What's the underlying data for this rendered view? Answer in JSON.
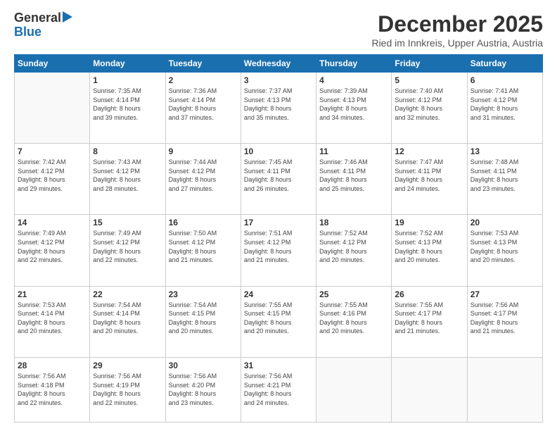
{
  "header": {
    "logo_line1": "General",
    "logo_line2": "Blue",
    "month": "December 2025",
    "location": "Ried im Innkreis, Upper Austria, Austria"
  },
  "weekdays": [
    "Sunday",
    "Monday",
    "Tuesday",
    "Wednesday",
    "Thursday",
    "Friday",
    "Saturday"
  ],
  "weeks": [
    [
      {
        "day": "",
        "info": ""
      },
      {
        "day": "1",
        "info": "Sunrise: 7:35 AM\nSunset: 4:14 PM\nDaylight: 8 hours\nand 39 minutes."
      },
      {
        "day": "2",
        "info": "Sunrise: 7:36 AM\nSunset: 4:14 PM\nDaylight: 8 hours\nand 37 minutes."
      },
      {
        "day": "3",
        "info": "Sunrise: 7:37 AM\nSunset: 4:13 PM\nDaylight: 8 hours\nand 35 minutes."
      },
      {
        "day": "4",
        "info": "Sunrise: 7:39 AM\nSunset: 4:13 PM\nDaylight: 8 hours\nand 34 minutes."
      },
      {
        "day": "5",
        "info": "Sunrise: 7:40 AM\nSunset: 4:12 PM\nDaylight: 8 hours\nand 32 minutes."
      },
      {
        "day": "6",
        "info": "Sunrise: 7:41 AM\nSunset: 4:12 PM\nDaylight: 8 hours\nand 31 minutes."
      }
    ],
    [
      {
        "day": "7",
        "info": "Sunrise: 7:42 AM\nSunset: 4:12 PM\nDaylight: 8 hours\nand 29 minutes."
      },
      {
        "day": "8",
        "info": "Sunrise: 7:43 AM\nSunset: 4:12 PM\nDaylight: 8 hours\nand 28 minutes."
      },
      {
        "day": "9",
        "info": "Sunrise: 7:44 AM\nSunset: 4:12 PM\nDaylight: 8 hours\nand 27 minutes."
      },
      {
        "day": "10",
        "info": "Sunrise: 7:45 AM\nSunset: 4:11 PM\nDaylight: 8 hours\nand 26 minutes."
      },
      {
        "day": "11",
        "info": "Sunrise: 7:46 AM\nSunset: 4:11 PM\nDaylight: 8 hours\nand 25 minutes."
      },
      {
        "day": "12",
        "info": "Sunrise: 7:47 AM\nSunset: 4:11 PM\nDaylight: 8 hours\nand 24 minutes."
      },
      {
        "day": "13",
        "info": "Sunrise: 7:48 AM\nSunset: 4:11 PM\nDaylight: 8 hours\nand 23 minutes."
      }
    ],
    [
      {
        "day": "14",
        "info": "Sunrise: 7:49 AM\nSunset: 4:12 PM\nDaylight: 8 hours\nand 22 minutes."
      },
      {
        "day": "15",
        "info": "Sunrise: 7:49 AM\nSunset: 4:12 PM\nDaylight: 8 hours\nand 22 minutes."
      },
      {
        "day": "16",
        "info": "Sunrise: 7:50 AM\nSunset: 4:12 PM\nDaylight: 8 hours\nand 21 minutes."
      },
      {
        "day": "17",
        "info": "Sunrise: 7:51 AM\nSunset: 4:12 PM\nDaylight: 8 hours\nand 21 minutes."
      },
      {
        "day": "18",
        "info": "Sunrise: 7:52 AM\nSunset: 4:12 PM\nDaylight: 8 hours\nand 20 minutes."
      },
      {
        "day": "19",
        "info": "Sunrise: 7:52 AM\nSunset: 4:13 PM\nDaylight: 8 hours\nand 20 minutes."
      },
      {
        "day": "20",
        "info": "Sunrise: 7:53 AM\nSunset: 4:13 PM\nDaylight: 8 hours\nand 20 minutes."
      }
    ],
    [
      {
        "day": "21",
        "info": "Sunrise: 7:53 AM\nSunset: 4:14 PM\nDaylight: 8 hours\nand 20 minutes."
      },
      {
        "day": "22",
        "info": "Sunrise: 7:54 AM\nSunset: 4:14 PM\nDaylight: 8 hours\nand 20 minutes."
      },
      {
        "day": "23",
        "info": "Sunrise: 7:54 AM\nSunset: 4:15 PM\nDaylight: 8 hours\nand 20 minutes."
      },
      {
        "day": "24",
        "info": "Sunrise: 7:55 AM\nSunset: 4:15 PM\nDaylight: 8 hours\nand 20 minutes."
      },
      {
        "day": "25",
        "info": "Sunrise: 7:55 AM\nSunset: 4:16 PM\nDaylight: 8 hours\nand 20 minutes."
      },
      {
        "day": "26",
        "info": "Sunrise: 7:55 AM\nSunset: 4:17 PM\nDaylight: 8 hours\nand 21 minutes."
      },
      {
        "day": "27",
        "info": "Sunrise: 7:56 AM\nSunset: 4:17 PM\nDaylight: 8 hours\nand 21 minutes."
      }
    ],
    [
      {
        "day": "28",
        "info": "Sunrise: 7:56 AM\nSunset: 4:18 PM\nDaylight: 8 hours\nand 22 minutes."
      },
      {
        "day": "29",
        "info": "Sunrise: 7:56 AM\nSunset: 4:19 PM\nDaylight: 8 hours\nand 22 minutes."
      },
      {
        "day": "30",
        "info": "Sunrise: 7:56 AM\nSunset: 4:20 PM\nDaylight: 8 hours\nand 23 minutes."
      },
      {
        "day": "31",
        "info": "Sunrise: 7:56 AM\nSunset: 4:21 PM\nDaylight: 8 hours\nand 24 minutes."
      },
      {
        "day": "",
        "info": ""
      },
      {
        "day": "",
        "info": ""
      },
      {
        "day": "",
        "info": ""
      }
    ]
  ]
}
